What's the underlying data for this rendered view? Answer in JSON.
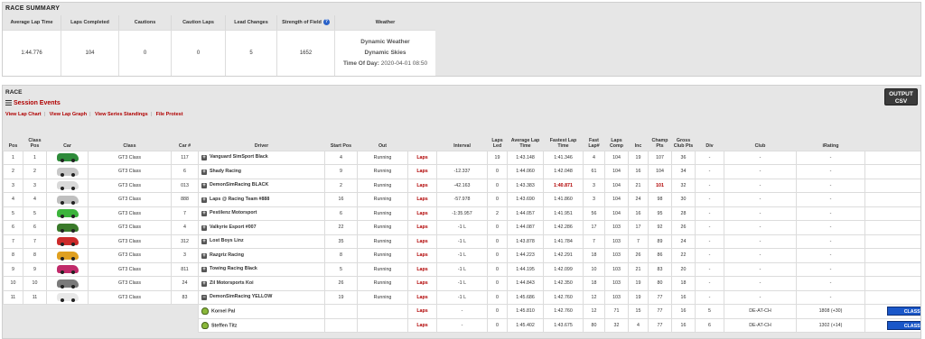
{
  "summary": {
    "title": "RACE SUMMARY",
    "headers": {
      "avg_lap": "Average Lap Time",
      "laps_completed": "Laps Completed",
      "cautions": "Cautions",
      "caution_laps": "Caution Laps",
      "lead_changes": "Lead Changes",
      "sof": "Strength of Field",
      "weather": "Weather"
    },
    "values": {
      "avg_lap": "1:44.776",
      "laps_completed": "104",
      "cautions": "0",
      "caution_laps": "0",
      "lead_changes": "5",
      "sof": "1652"
    },
    "weather": {
      "line1": "Dynamic Weather",
      "line2": "Dynamic Skies",
      "tod_label": "Time Of Day:",
      "tod_value": "2020-04-01 08:50"
    }
  },
  "race": {
    "title": "RACE",
    "session_events": "Session Events",
    "links": [
      "View Lap Chart",
      "View Lap Graph",
      "View Series Standings",
      "File Protest"
    ],
    "csv_button": [
      "OUTPUT",
      "CSV"
    ]
  },
  "columns": [
    "Pos",
    "Class Pos",
    "Car",
    "Class",
    "Car #",
    "Driver",
    "Start Pos",
    "Out",
    "",
    "Interval",
    "Laps Led",
    "Average Lap Time",
    "Fastest Lap Time",
    "Fast Lap#",
    "Laps Comp",
    "Inc",
    "Champ Pts",
    "Gross Club Pts",
    "Div",
    "Club",
    "iRating",
    "License"
  ],
  "rows": [
    {
      "pos": "1",
      "cpos": "1",
      "car_color": "#2e8b3a",
      "cls": "GT3 Class",
      "num": "117",
      "driver": "Vanguard SimSport Black",
      "start": "4",
      "out": "Running",
      "laps": "Laps",
      "interval": "",
      "led": "19",
      "avg": "1:43.148",
      "fast": "1:41.346",
      "fastlap": "4",
      "comp": "104",
      "inc": "19",
      "champ": "107",
      "gross": "36",
      "div": "-",
      "club": "-",
      "irating": "-",
      "license": "- - -"
    },
    {
      "pos": "2",
      "cpos": "2",
      "car_color": "#c8c8c8",
      "cls": "GT3 Class",
      "num": "6",
      "driver": "Shady Racing",
      "start": "9",
      "out": "Running",
      "laps": "Laps",
      "interval": "-12.337",
      "led": "0",
      "avg": "1:44.060",
      "fast": "1:42.048",
      "fastlap": "61",
      "comp": "104",
      "inc": "16",
      "champ": "104",
      "gross": "34",
      "div": "-",
      "club": "-",
      "irating": "-",
      "license": "- - -"
    },
    {
      "pos": "3",
      "cpos": "3",
      "car_color": "#d9d9d9",
      "cls": "GT3 Class",
      "num": "013",
      "driver": "DemonSimRacing BLACK",
      "start": "2",
      "out": "Running",
      "laps": "Laps",
      "interval": "-42.163",
      "led": "0",
      "avg": "1:43.383",
      "fast": "1:40.871",
      "fastlap": "3",
      "comp": "104",
      "inc": "21",
      "champ": "101",
      "gross": "32",
      "div": "-",
      "club": "-",
      "irating": "-",
      "license": "- - -"
    },
    {
      "pos": "4",
      "cpos": "4",
      "car_color": "#bfbfbf",
      "cls": "GT3 Class",
      "num": "888",
      "driver": "Laps @ Racing Team #888",
      "start": "16",
      "out": "Running",
      "laps": "Laps",
      "interval": "-57.978",
      "led": "0",
      "avg": "1:43.690",
      "fast": "1:41.860",
      "fastlap": "3",
      "comp": "104",
      "inc": "24",
      "champ": "98",
      "gross": "30",
      "div": "-",
      "club": "-",
      "irating": "-",
      "license": "- - -"
    },
    {
      "pos": "5",
      "cpos": "5",
      "car_color": "#3cb43c",
      "cls": "GT3 Class",
      "num": "7",
      "driver": "Pestilenz Motorsport",
      "start": "6",
      "out": "Running",
      "laps": "Laps",
      "interval": "-1:35.957",
      "led": "2",
      "avg": "1:44.057",
      "fast": "1:41.951",
      "fastlap": "56",
      "comp": "104",
      "inc": "16",
      "champ": "95",
      "gross": "28",
      "div": "-",
      "club": "-",
      "irating": "-",
      "license": "- - -"
    },
    {
      "pos": "6",
      "cpos": "6",
      "car_color": "#3a7a2a",
      "cls": "GT3 Class",
      "num": "4",
      "driver": "Valkyrie Esport #007",
      "start": "22",
      "out": "Running",
      "laps": "Laps",
      "interval": "-1 L",
      "led": "0",
      "avg": "1:44.087",
      "fast": "1:42.286",
      "fastlap": "17",
      "comp": "103",
      "inc": "17",
      "champ": "92",
      "gross": "26",
      "div": "-",
      "club": "-",
      "irating": "-",
      "license": "- - -"
    },
    {
      "pos": "7",
      "cpos": "7",
      "car_color": "#cc2a2a",
      "cls": "GT3 Class",
      "num": "312",
      "driver": "Lost Boys Linz",
      "start": "35",
      "out": "Running",
      "laps": "Laps",
      "interval": "-1 L",
      "led": "0",
      "avg": "1:43.878",
      "fast": "1:41.784",
      "fastlap": "7",
      "comp": "103",
      "inc": "7",
      "champ": "89",
      "gross": "24",
      "div": "-",
      "club": "-",
      "irating": "-",
      "license": "- - -"
    },
    {
      "pos": "8",
      "cpos": "8",
      "car_color": "#e0a020",
      "cls": "GT3 Class",
      "num": "3",
      "driver": "Razgriz Racing",
      "start": "8",
      "out": "Running",
      "laps": "Laps",
      "interval": "-1 L",
      "led": "0",
      "avg": "1:44.223",
      "fast": "1:42.291",
      "fastlap": "18",
      "comp": "103",
      "inc": "26",
      "champ": "86",
      "gross": "22",
      "div": "-",
      "club": "-",
      "irating": "-",
      "license": "- - -"
    },
    {
      "pos": "9",
      "cpos": "9",
      "car_color": "#c02a6a",
      "cls": "GT3 Class",
      "num": "811",
      "driver": "Towing Racing Black",
      "start": "5",
      "out": "Running",
      "laps": "Laps",
      "interval": "-1 L",
      "led": "0",
      "avg": "1:44.195",
      "fast": "1:42.099",
      "fastlap": "10",
      "comp": "103",
      "inc": "21",
      "champ": "83",
      "gross": "20",
      "div": "-",
      "club": "-",
      "irating": "-",
      "license": "- - -"
    },
    {
      "pos": "10",
      "cpos": "10",
      "car_color": "#7a7a7a",
      "cls": "GT3 Class",
      "num": "24",
      "driver": "Zil Motorsports Koi",
      "start": "26",
      "out": "Running",
      "laps": "Laps",
      "interval": "-1 L",
      "led": "0",
      "avg": "1:44.843",
      "fast": "1:42.350",
      "fastlap": "18",
      "comp": "103",
      "inc": "19",
      "champ": "80",
      "gross": "18",
      "div": "-",
      "club": "-",
      "irating": "-",
      "license": "- - -"
    },
    {
      "pos": "11",
      "cpos": "11",
      "car_color": "#e8e8e8",
      "cls": "GT3 Class",
      "num": "83",
      "driver": "DemonSimRacing YELLOW",
      "start": "19",
      "out": "Running",
      "laps": "Laps",
      "interval": "-1 L",
      "led": "0",
      "avg": "1:45.686",
      "fast": "1:42.760",
      "fastlap": "12",
      "comp": "103",
      "inc": "19",
      "champ": "77",
      "gross": "16",
      "div": "-",
      "club": "-",
      "irating": "-",
      "license": "- - -"
    }
  ],
  "team_drivers": [
    {
      "driver": "Kornel Pal",
      "laps": "Laps",
      "interval": "-",
      "led": "0",
      "avg": "1:45.810",
      "fast": "1:42.760",
      "fastlap": "12",
      "comp": "71",
      "inc": "15",
      "champ": "77",
      "gross": "16",
      "div": "5",
      "club": "DE-AT-CH",
      "irating": "1808 (+30)",
      "license": "CLASS A 3.70",
      "license_delta": "(+0.08)"
    },
    {
      "driver": "Steffen Titz",
      "laps": "Laps",
      "interval": "-",
      "led": "0",
      "avg": "1:45.402",
      "fast": "1:43.675",
      "fastlap": "80",
      "comp": "32",
      "inc": "4",
      "champ": "77",
      "gross": "16",
      "div": "6",
      "club": "DE-AT-CH",
      "irating": "1302 (+14)",
      "license": "CLASS A 4.16",
      "license_delta": "(+0.12)"
    }
  ],
  "highlight": {
    "fastest_row_index": 2,
    "red_champ_row_index": 2
  },
  "colors": {
    "link_red": "#b00000",
    "badge_blue": "#1a57c9",
    "panel_gray": "#e6e6e6",
    "help_blue": "#2a62c9"
  }
}
